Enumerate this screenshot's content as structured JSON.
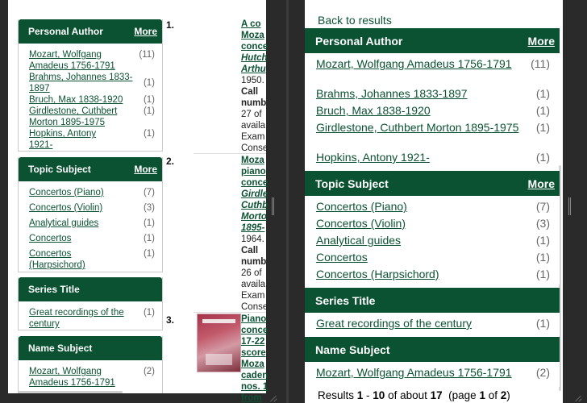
{
  "left": {
    "facets": [
      {
        "title": "Personal Author",
        "more": "More",
        "items": [
          {
            "label": "Mozart, Wolfgang Amadeus 1756-1791",
            "count": "(11)"
          },
          {
            "label": "Brahms, Johannes 1833-1897",
            "count": "(1)"
          },
          {
            "label": "Bruch, Max 1838-1920",
            "count": "(1)"
          },
          {
            "label": "Girdlestone, Cuthbert Morton 1895-1975",
            "count": "(1)"
          },
          {
            "label": "Hopkins, Antony 1921-",
            "count": "(1)"
          }
        ]
      },
      {
        "title": "Topic Subject",
        "more": "More",
        "items": [
          {
            "label": "Concertos (Piano)",
            "count": "(7)"
          },
          {
            "label": "Concertos (Violin)",
            "count": "(3)"
          },
          {
            "label": "Analytical guides",
            "count": "(1)"
          },
          {
            "label": "Concertos",
            "count": "(1)"
          },
          {
            "label": "Concertos (Harpsichord)",
            "count": "(1)"
          }
        ]
      },
      {
        "title": "Series Title",
        "items": [
          {
            "label": "Great recordings of the century",
            "count": "(1)"
          }
        ]
      },
      {
        "title": "Name Subject",
        "items": [
          {
            "label": "Mozart, Wolfgang Amadeus 1756-1791",
            "count": "(2)"
          }
        ]
      }
    ],
    "results": [
      {
        "num": "1.",
        "lines": [
          "A co",
          "Moza",
          "conce"
        ],
        "author": [
          "Hutch",
          "Arthu"
        ],
        "rest": [
          "1950."
        ],
        "label": [
          "Call",
          "numb"
        ],
        "tail": [
          "27 of",
          "availa",
          "Exam",
          "Conse"
        ]
      },
      {
        "num": "2.",
        "lines": [
          "Moza",
          "piano",
          "conce"
        ],
        "author": [
          "Girdle",
          "Cuthb",
          "Morto",
          "1895-"
        ],
        "rest": [
          "1964."
        ],
        "label": [
          "Call",
          "numb"
        ],
        "tail": [
          "26 of",
          "availa",
          "Exam",
          "Conse"
        ]
      },
      {
        "num": "3.",
        "lines": [
          "Piano",
          "conce",
          "17-22",
          "score",
          "Moza",
          "caden",
          "nos. 1",
          "from"
        ],
        "author": [],
        "rest": [],
        "label": [],
        "tail": []
      }
    ]
  },
  "right": {
    "back": "Back to results",
    "facets": [
      {
        "title": "Personal Author",
        "more": "More",
        "items": [
          {
            "label": "Mozart, Wolfgang Amadeus 1756-1791",
            "count": "(11)"
          },
          {
            "label": "Brahms, Johannes 1833-1897",
            "count": "(1)"
          },
          {
            "label": "Bruch, Max 1838-1920",
            "count": "(1)"
          },
          {
            "label": "Girdlestone, Cuthbert Morton 1895-1975",
            "count": "(1)"
          },
          {
            "label": "Hopkins, Antony 1921-",
            "count": "(1)"
          }
        ]
      },
      {
        "title": "Topic Subject",
        "more": "More",
        "items": [
          {
            "label": "Concertos (Piano)",
            "count": "(7)"
          },
          {
            "label": "Concertos (Violin)",
            "count": "(3)"
          },
          {
            "label": "Analytical guides",
            "count": "(1)"
          },
          {
            "label": "Concertos",
            "count": "(1)"
          },
          {
            "label": "Concertos (Harpsichord)",
            "count": "(1)"
          }
        ]
      },
      {
        "title": "Series Title",
        "items": [
          {
            "label": "Great recordings of the century",
            "count": "(1)"
          }
        ]
      },
      {
        "title": "Name Subject",
        "items": [
          {
            "label": "Mozart, Wolfgang Amadeus 1756-1791",
            "count": "(2)"
          }
        ]
      }
    ],
    "results_bar": {
      "prefix": "Results ",
      "from": "1",
      "dash": " - ",
      "to": "10",
      "of_about": " of about ",
      "total": "17",
      "page_open": "  (page ",
      "page": "1",
      "of": " of ",
      "pages": "2",
      "close": ")"
    }
  }
}
